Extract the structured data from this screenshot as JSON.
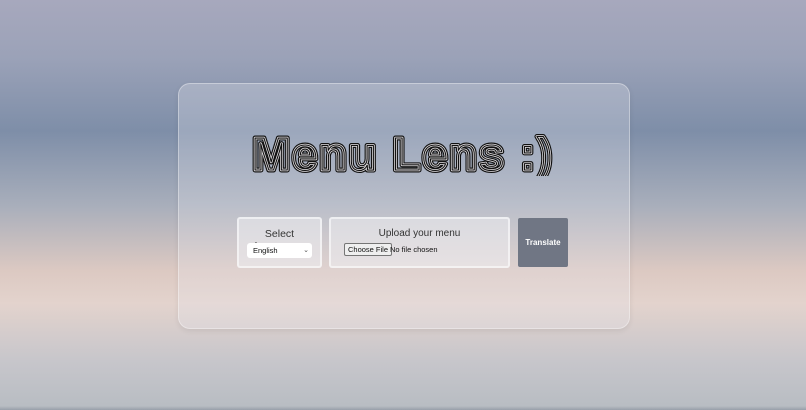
{
  "logo": {
    "text": "Menu Lens :)"
  },
  "language": {
    "label": "Select Language:",
    "selected": "English"
  },
  "upload": {
    "title": "Upload your menu",
    "button_label": "Choose File",
    "status": "No file chosen"
  },
  "actions": {
    "translate_label": "Translate"
  },
  "colors": {
    "button": "#707684",
    "logo": "#111111"
  }
}
